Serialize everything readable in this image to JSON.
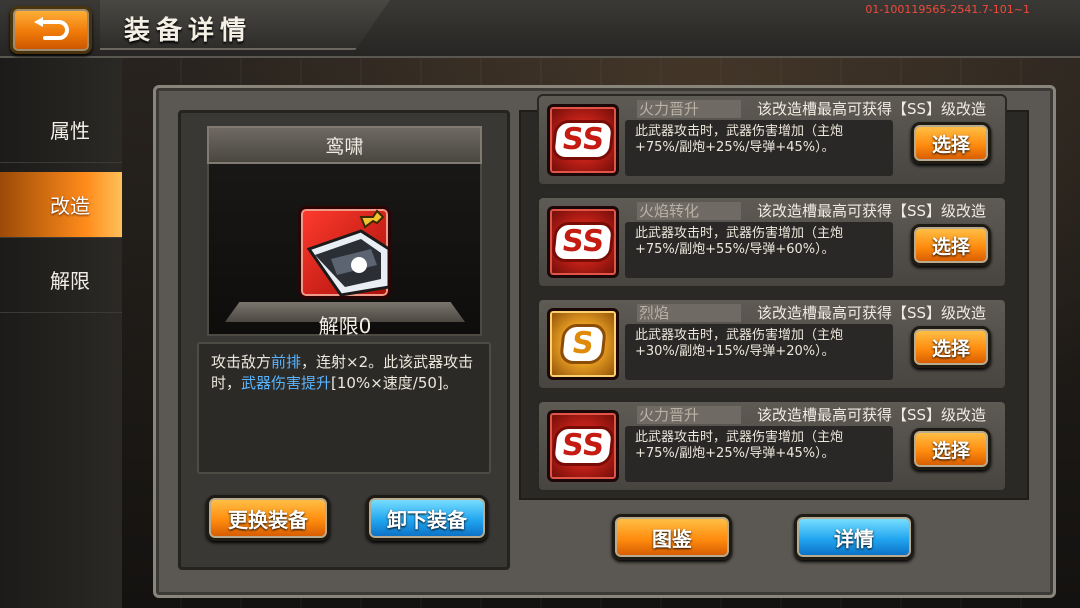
{
  "header": {
    "title": "装备详情",
    "version": "01-100119565-2541.7-101~1",
    "back_icon": "return-arrow-icon"
  },
  "sidebar": {
    "items": [
      {
        "label": "属性",
        "active": false
      },
      {
        "label": "改造",
        "active": true
      },
      {
        "label": "解限",
        "active": false
      }
    ]
  },
  "equipment": {
    "name": "鸾啸",
    "limit_break": "解限0",
    "description_parts": [
      {
        "text": "攻击敌方",
        "highlight": false
      },
      {
        "text": "前排",
        "highlight": true
      },
      {
        "text": "，连射×2。此该武器攻击时，",
        "highlight": false
      },
      {
        "text": "武器伤害提升",
        "highlight": true
      },
      {
        "text": "[10%×速度/50]。",
        "highlight": false
      }
    ],
    "buttons": {
      "replace": "更换装备",
      "unequip": "卸下装备"
    }
  },
  "mods": [
    {
      "name": "火力晋升",
      "note": "该改造槽最高可获得【SS】级改造",
      "desc": "此武器攻击时，武器伤害增加（主炮+75%/副炮+25%/导弹+45%）。",
      "grade": "SS",
      "button": "选择"
    },
    {
      "name": "火焰转化",
      "note": "该改造槽最高可获得【SS】级改造",
      "desc": "此武器攻击时，武器伤害增加（主炮+75%/副炮+55%/导弹+60%）。",
      "grade": "SS",
      "button": "选择"
    },
    {
      "name": "烈焰",
      "note": "该改造槽最高可获得【SS】级改造",
      "desc": "此武器攻击时，武器伤害增加（主炮+30%/副炮+15%/导弹+20%）。",
      "grade": "S",
      "button": "选择"
    },
    {
      "name": "火力晋升",
      "note": "该改造槽最高可获得【SS】级改造",
      "desc": "此武器攻击时，武器伤害增加（主炮+75%/副炮+25%/导弹+45%）。",
      "grade": "SS",
      "button": "选择"
    }
  ],
  "footer": {
    "codex": "图鉴",
    "details": "详情"
  },
  "colors": {
    "accent_orange": "#ff8c0f",
    "accent_blue": "#22a6f0",
    "highlight_text": "#58b4ff",
    "version_text": "#f04a3a"
  }
}
